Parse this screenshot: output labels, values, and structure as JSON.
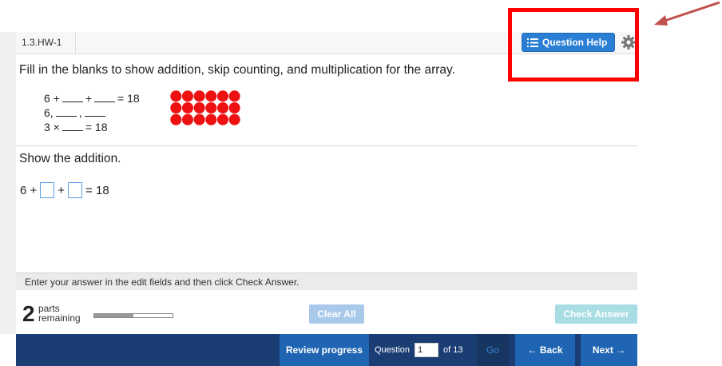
{
  "header": {
    "assignment_label": "1.3.HW-1",
    "help_button_label": "Question Help",
    "help_icon": "list-icon",
    "settings_icon": "gear-icon"
  },
  "question": {
    "instructions": "Fill in the blanks to show addition, skip counting, and multiplication for the array.",
    "equations": {
      "line1_start": "6 +",
      "line1_plus": "+",
      "line1_end": "= 18",
      "line2_start": "6,",
      "line2_comma": ",",
      "line3_start": "3 ×",
      "line3_end": "= 18"
    },
    "array": {
      "rows": 3,
      "cols": 6,
      "dot_color": "#ee1111"
    },
    "part_prompt": "Show the addition.",
    "answer": {
      "prefix": "6 +",
      "plus": "+",
      "suffix": "= 18",
      "box1_value": "",
      "box2_value": ""
    }
  },
  "hint": {
    "text": "Enter your answer in the edit fields and then click Check Answer."
  },
  "status": {
    "parts_count": "2",
    "parts_word": "parts",
    "remaining_word": "remaining",
    "progress_fraction": 0.5,
    "clear_all_label": "Clear All",
    "check_answer_label": "Check Answer"
  },
  "nav": {
    "review_label": "Review progress",
    "question_label": "Question",
    "question_value": "1",
    "of_label": "of 13",
    "go_label": "Go",
    "back_label": "← Back",
    "next_label": "Next →"
  },
  "colors": {
    "highlight_box": "#ff0000",
    "arrow": "#c0504d",
    "help_button": "#2a7fd4",
    "nav_bar": "#1a3d73",
    "nav_button": "#2065b3"
  }
}
